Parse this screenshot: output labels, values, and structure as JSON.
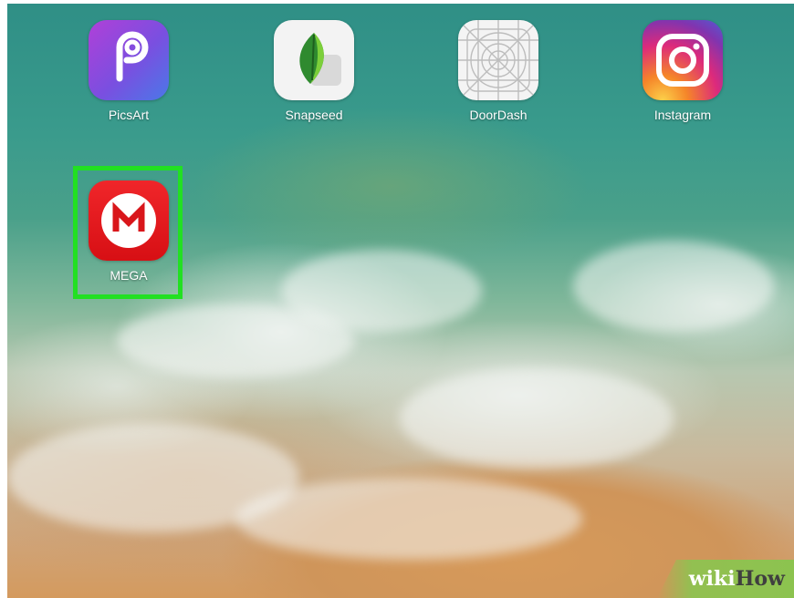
{
  "home_screen": {
    "apps": [
      {
        "label": "PicsArt",
        "icon": "picsart-icon"
      },
      {
        "label": "Snapseed",
        "icon": "snapseed-icon"
      },
      {
        "label": "DoorDash",
        "icon": "doordash-icon"
      },
      {
        "label": "Instagram",
        "icon": "instagram-icon"
      },
      {
        "label": "MEGA",
        "icon": "mega-icon",
        "highlighted": true
      }
    ],
    "highlight_color": "#22e022"
  },
  "watermark": {
    "part1": "wiki",
    "part2": "How"
  }
}
